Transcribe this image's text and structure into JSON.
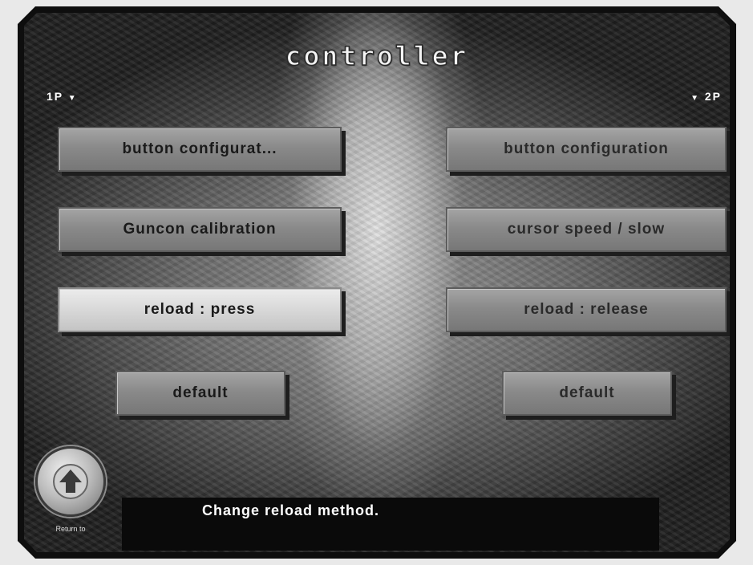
{
  "screen": {
    "title": "controller"
  },
  "players": {
    "p1_label": "1P",
    "p2_label": "2P"
  },
  "p1_buttons": {
    "button_config": "button configurat...",
    "guncon_calibration": "Guncon calibration",
    "reload": "reload : press",
    "default": "default"
  },
  "p2_buttons": {
    "button_config": "button configuration",
    "cursor_speed": "cursor speed / slow",
    "reload": "reload : release",
    "default": "default"
  },
  "description": {
    "text": "Change reload method."
  },
  "back": {
    "label": "Return to"
  },
  "colors": {
    "button_normal": "#8a8a8a",
    "button_selected": "#d8d8d8",
    "description_bg": "#0a0a0a",
    "text_light": "#ffffff"
  },
  "selected_item": "reload : press"
}
